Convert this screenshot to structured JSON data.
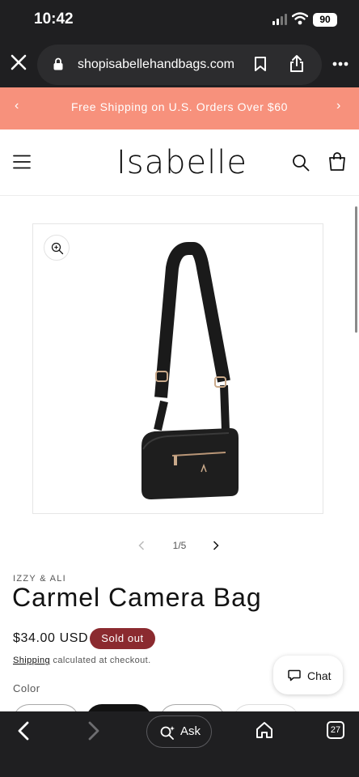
{
  "status_bar": {
    "time": "10:42",
    "battery": "90"
  },
  "browser": {
    "url": "shopisabellehandbags.com",
    "ask_label": "Ask",
    "tab_count": "27"
  },
  "announcement": {
    "text": "Free Shipping on U.S. Orders Over $60"
  },
  "header": {
    "logo": "Isabelle"
  },
  "gallery": {
    "counter": "1/5"
  },
  "product": {
    "vendor": "IZZY & ALI",
    "title": "Carmel Camera Bag",
    "price": "$34.00 USD",
    "badge": "Sold out",
    "shipping_link": "Shipping",
    "shipping_text": " calculated at checkout.",
    "color_label": "Color"
  },
  "chat": {
    "label": "Chat"
  },
  "colors": {
    "announce_bg": "#f7917c",
    "sold_badge": "#8b2a2f",
    "chrome": "#1f1f21"
  },
  "icons": [
    "close-icon",
    "lock-icon",
    "bookmark-icon",
    "share-icon",
    "more-icon",
    "menu-icon",
    "search-icon",
    "cart-icon",
    "zoom-icon",
    "chevron-left-icon",
    "chevron-right-icon",
    "chat-icon",
    "back-icon",
    "forward-icon",
    "sparkle-search-icon",
    "home-icon"
  ]
}
